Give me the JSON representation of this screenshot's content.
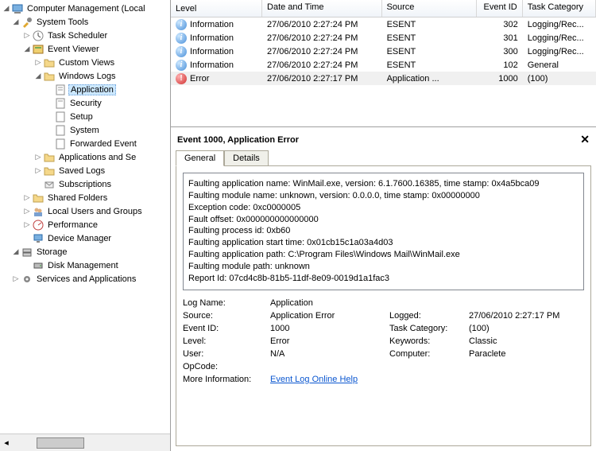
{
  "tree": {
    "root": "Computer Management (Local",
    "system_tools": "System Tools",
    "task_scheduler": "Task Scheduler",
    "event_viewer": "Event Viewer",
    "custom_views": "Custom Views",
    "windows_logs": "Windows Logs",
    "application": "Application",
    "security": "Security",
    "setup": "Setup",
    "system": "System",
    "forwarded": "Forwarded Event",
    "apps_and_services": "Applications and Se",
    "saved_logs": "Saved Logs",
    "subscriptions": "Subscriptions",
    "shared_folders": "Shared Folders",
    "local_users": "Local Users and Groups",
    "performance": "Performance",
    "device_manager": "Device Manager",
    "storage": "Storage",
    "disk_management": "Disk Management",
    "services_apps": "Services and Applications"
  },
  "grid": {
    "columns": {
      "level": "Level",
      "date": "Date and Time",
      "source": "Source",
      "eventid": "Event ID",
      "taskcat": "Task Category"
    },
    "rows": [
      {
        "icon": "info",
        "level": "Information",
        "date": "27/06/2010 2:27:24 PM",
        "source": "ESENT",
        "eventid": "302",
        "taskcat": "Logging/Rec..."
      },
      {
        "icon": "info",
        "level": "Information",
        "date": "27/06/2010 2:27:24 PM",
        "source": "ESENT",
        "eventid": "301",
        "taskcat": "Logging/Rec..."
      },
      {
        "icon": "info",
        "level": "Information",
        "date": "27/06/2010 2:27:24 PM",
        "source": "ESENT",
        "eventid": "300",
        "taskcat": "Logging/Rec..."
      },
      {
        "icon": "info",
        "level": "Information",
        "date": "27/06/2010 2:27:24 PM",
        "source": "ESENT",
        "eventid": "102",
        "taskcat": "General"
      },
      {
        "icon": "error",
        "level": "Error",
        "date": "27/06/2010 2:27:17 PM",
        "source": "Application ...",
        "eventid": "1000",
        "taskcat": "(100)"
      }
    ]
  },
  "detail": {
    "title": "Event 1000, Application Error",
    "tabs": {
      "general": "General",
      "details": "Details"
    },
    "description": [
      "Faulting application name: WinMail.exe, version: 6.1.7600.16385, time stamp: 0x4a5bca09",
      "Faulting module name: unknown, version: 0.0.0.0, time stamp: 0x00000000",
      "Exception code: 0xc0000005",
      "Fault offset: 0x000000000000000",
      "Faulting process id: 0xb60",
      "Faulting application start time: 0x01cb15c1a03a4d03",
      "Faulting application path: C:\\Program Files\\Windows Mail\\WinMail.exe",
      "Faulting module path: unknown",
      "Report Id: 07cd4c8b-81b5-11df-8e09-0019d1a1fac3"
    ],
    "props": {
      "logname_k": "Log Name:",
      "logname_v": "Application",
      "source_k": "Source:",
      "source_v": "Application Error",
      "logged_k": "Logged:",
      "logged_v": "27/06/2010 2:27:17 PM",
      "eventid_k": "Event ID:",
      "eventid_v": "1000",
      "taskcat_k": "Task Category:",
      "taskcat_v": "(100)",
      "level_k": "Level:",
      "level_v": "Error",
      "keywords_k": "Keywords:",
      "keywords_v": "Classic",
      "user_k": "User:",
      "user_v": "N/A",
      "computer_k": "Computer:",
      "computer_v": "Paraclete",
      "opcode_k": "OpCode:",
      "moreinfo_k": "More Information:",
      "moreinfo_v": "Event Log Online Help"
    }
  }
}
